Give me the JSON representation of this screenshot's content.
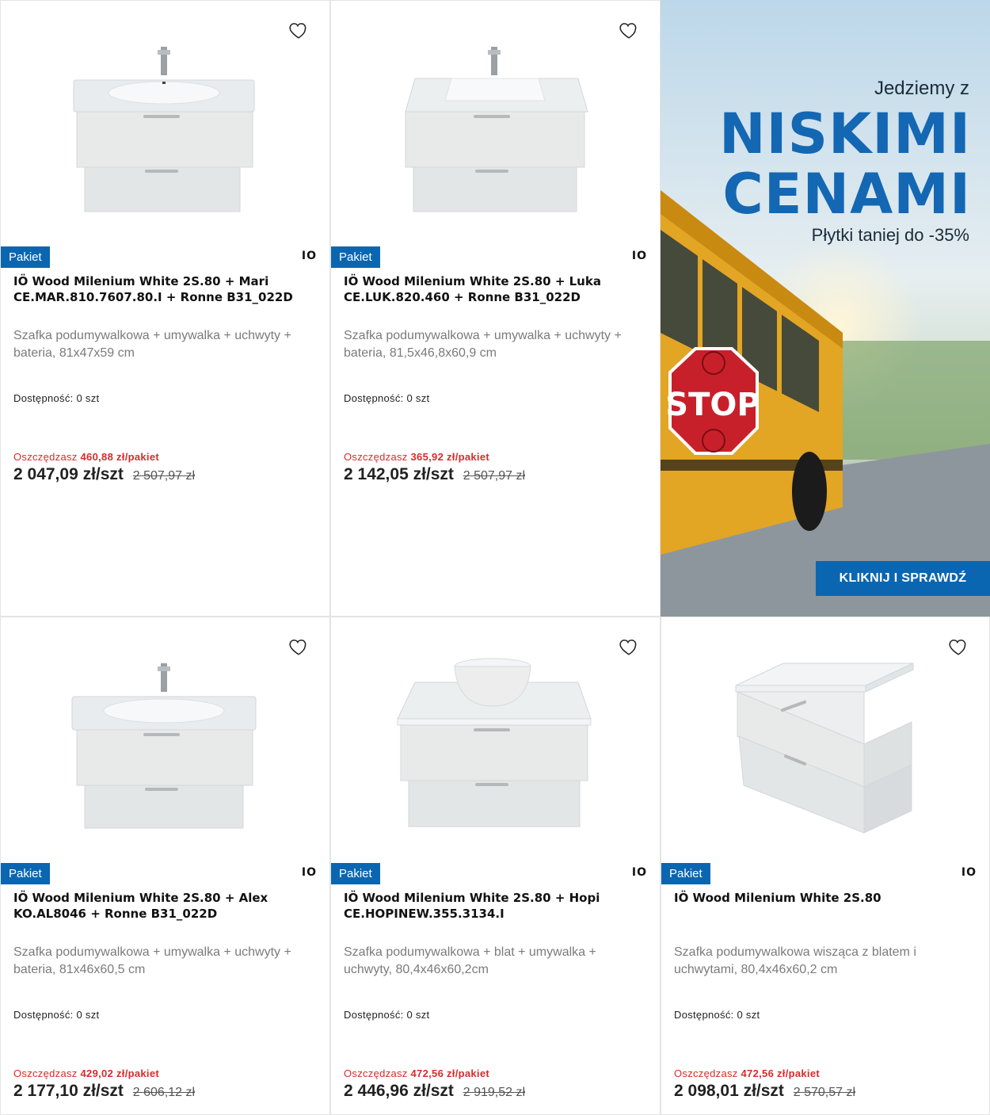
{
  "colors": {
    "accent": "#0b66b1",
    "savings": "#d72b2b",
    "promo_heading": "#1467b3"
  },
  "products": [
    {
      "badge": "Pakiet",
      "brand": "IO",
      "title": "IÖ Wood Milenium White 2S.80 + Mari CE.MAR.810.7607.80.I + Ronne B31_022D",
      "description": "Szafka podumywalkowa + umywalka + uchwyty + bateria, 81x47x59 cm",
      "availability_label": "Dostępność:",
      "availability_value": "0 szt",
      "savings_label": "Oszczędzasz",
      "savings_value": "460,88 zł/pakiet",
      "price": "2 047,09 zł/szt",
      "old_price": "2 507,97 zł",
      "image": "vanity-with-integrated-basin-and-faucet"
    },
    {
      "badge": "Pakiet",
      "brand": "IO",
      "title": "IÖ Wood Milenium White 2S.80 + Luka CE.LUK.820.460 + Ronne B31_022D",
      "description": "Szafka podumywalkowa + umywalka + uchwyty + bateria, 81,5x46,8x60,9 cm",
      "availability_label": "Dostępność:",
      "availability_value": "0 szt",
      "savings_label": "Oszczędzasz",
      "savings_value": "365,92 zł/pakiet",
      "price": "2 142,05 zł/szt",
      "old_price": "2 507,97 zł",
      "image": "vanity-with-square-basin-and-faucet"
    },
    {
      "badge": "Pakiet",
      "brand": "IO",
      "title": "IÖ Wood Milenium White 2S.80 + Alex KO.AL8046 + Ronne B31_022D",
      "description": "Szafka podumywalkowa + umywalka + uchwyty + bateria, 81x46x60,5 cm",
      "availability_label": "Dostępność:",
      "availability_value": "0 szt",
      "savings_label": "Oszczędzasz",
      "savings_value": "429,02 zł/pakiet",
      "price": "2 177,10 zł/szt",
      "old_price": "2 606,12 zł",
      "image": "vanity-with-integrated-basin-and-faucet"
    },
    {
      "badge": "Pakiet",
      "brand": "IO",
      "title": "IÖ Wood Milenium White 2S.80 + Hopi CE.HOPINEW.355.3134.I",
      "description": "Szafka podumywalkowa + blat + umywalka + uchwyty, 80,4x46x60,2cm",
      "availability_label": "Dostępność:",
      "availability_value": "0 szt",
      "savings_label": "Oszczędzasz",
      "savings_value": "472,56 zł/pakiet",
      "price": "2 446,96 zł/szt",
      "old_price": "2 919,52 zł",
      "image": "vanity-with-countertop-bowl-basin"
    },
    {
      "badge": "Pakiet",
      "brand": "IO",
      "title": "IÖ Wood Milenium White 2S.80",
      "description": "Szafka podumywalkowa wisząca z blatem i uchwytami, 80,4x46x60,2 cm",
      "availability_label": "Dostępność:",
      "availability_value": "0 szt",
      "savings_label": "Oszczędzasz",
      "savings_value": "472,56 zł/pakiet",
      "price": "2 098,01 zł/szt",
      "old_price": "2 570,57 zł",
      "image": "vanity-cabinet-angled"
    }
  ],
  "promo": {
    "line1": "Jedziemy z",
    "big1": "NISKIMI",
    "big2": "CENAMI",
    "line2": "Płytki taniej do -35%",
    "sign_text": "STOP",
    "button": "KLIKNIJ I SPRAWDŹ",
    "image": "school-bus-with-stop-sign"
  }
}
